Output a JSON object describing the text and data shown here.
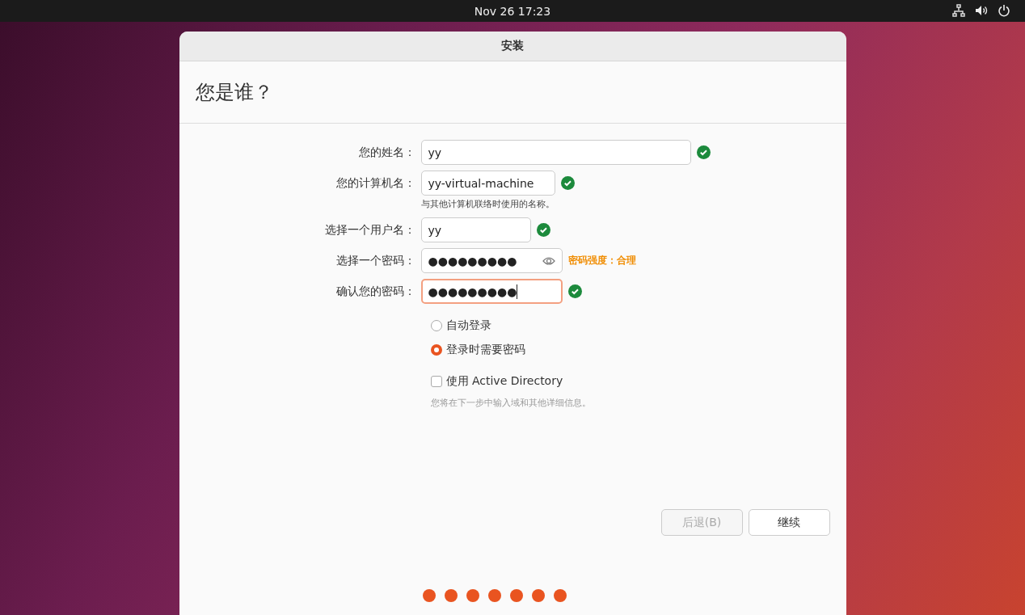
{
  "top_bar": {
    "clock": "Nov 26  17:23"
  },
  "window": {
    "title": "安装"
  },
  "heading": "您是谁？",
  "fields": [
    {
      "label": "您的姓名：",
      "value": "yy",
      "valid": true,
      "focused": false,
      "reveal_icon": false
    },
    {
      "label": "您的计算机名：",
      "value": "yy-virtual-machine",
      "valid": true,
      "focused": false,
      "reveal_icon": false,
      "hint": "与其他计算机联络时使用的名称。"
    },
    {
      "label": "选择一个用户名：",
      "value": "yy",
      "valid": true,
      "focused": false,
      "reveal_icon": false
    },
    {
      "label": "选择一个密码：",
      "value": "●●●●●●●●●",
      "valid": false,
      "focused": false,
      "reveal_icon": true,
      "strength": "密码强度：合理"
    },
    {
      "label": "确认您的密码：",
      "value": "●●●●●●●●●",
      "valid": true,
      "focused": true,
      "reveal_icon": false
    }
  ],
  "login_options": [
    {
      "label": "自动登录",
      "selected": false
    },
    {
      "label": "登录时需要密码",
      "selected": true
    }
  ],
  "active_directory": {
    "label": "使用 Active Directory",
    "checked": false,
    "hint": "您将在下一步中输入域和其他详细信息。"
  },
  "buttons": [
    {
      "label": "后退(B)",
      "disabled": true
    },
    {
      "label": "继续",
      "disabled": false
    }
  ],
  "progress_steps": [
    {
      "done": true
    },
    {
      "done": true
    },
    {
      "done": true
    },
    {
      "done": true
    },
    {
      "done": true
    },
    {
      "done": true
    },
    {
      "done": true
    }
  ]
}
